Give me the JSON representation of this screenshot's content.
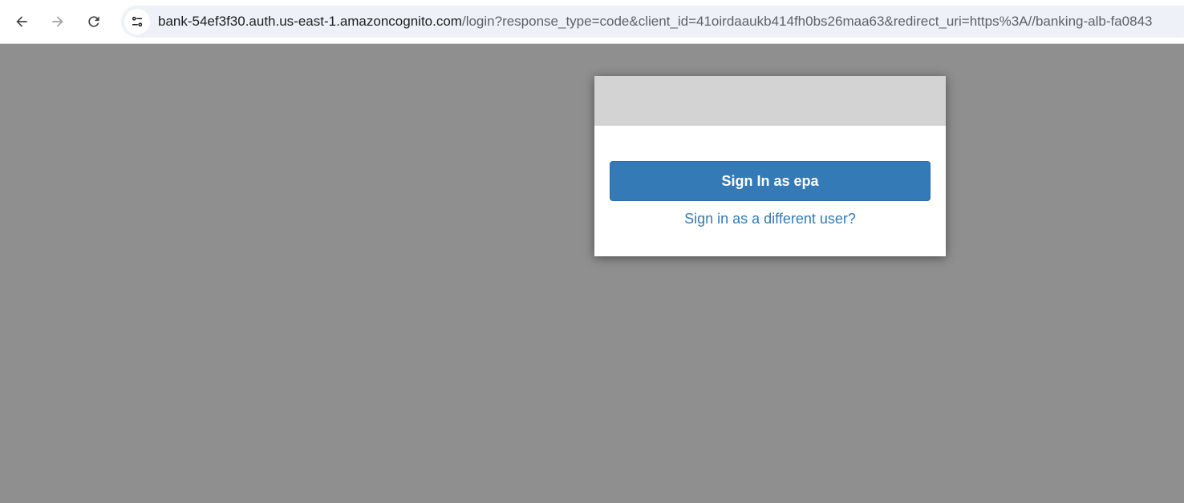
{
  "browser": {
    "url_host": "bank-54ef3f30.auth.us-east-1.amazoncognito.com",
    "url_rest": "/login?response_type=code&client_id=41oirdaaukb414fh0bs26maa63&redirect_uri=https%3A//banking-alb-fa0843",
    "icons": {
      "back": "arrow-left-icon",
      "forward": "arrow-right-icon",
      "reload": "reload-icon",
      "site_info": "tune-icon"
    }
  },
  "login_card": {
    "signin_button_label": "Sign In as epa",
    "different_user_link": "Sign in as a different user?"
  },
  "colors": {
    "page_background": "#8f8f8f",
    "card_header": "#d3d3d3",
    "primary_button": "#337ab7",
    "link": "#337ab7"
  }
}
